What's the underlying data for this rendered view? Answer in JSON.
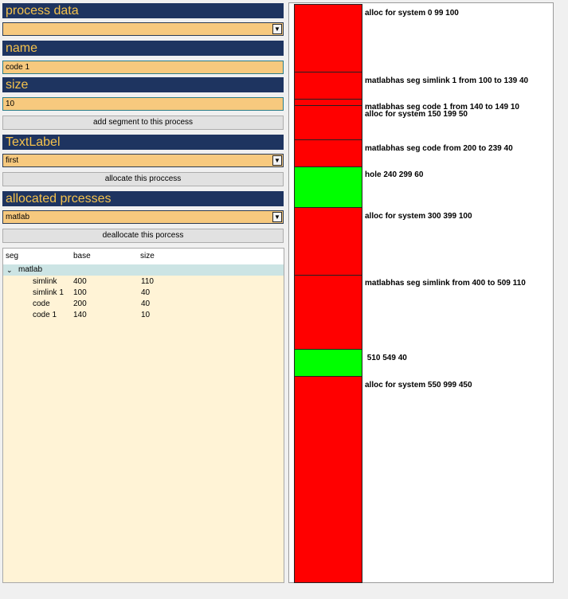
{
  "colors": {
    "alloc": "#ff0000",
    "hole": "#00ff00"
  },
  "process_data": {
    "header": "process data",
    "value": ""
  },
  "name": {
    "header": "name",
    "value": "code 1"
  },
  "size": {
    "header": "size",
    "value": "10"
  },
  "add_segment_label": "add segment to this process",
  "text_label": {
    "header": "TextLabel",
    "value": "first"
  },
  "allocate_label": "allocate this proccess",
  "allocated": {
    "header": "allocated prcesses",
    "value": "matlab"
  },
  "deallocate_label": "deallocate this porcess",
  "tree": {
    "columns": [
      "seg",
      "base",
      "size"
    ],
    "parent": "matlab",
    "rows": [
      {
        "seg": "simlink",
        "base": "400",
        "size": "110"
      },
      {
        "seg": "simlink 1",
        "base": "100",
        "size": "40"
      },
      {
        "seg": "code",
        "base": "200",
        "size": "40"
      },
      {
        "seg": "code 1",
        "base": "140",
        "size": "10"
      }
    ]
  },
  "memory_map": [
    {
      "type": "alloc",
      "label": "alloc for system 0 99 100"
    },
    {
      "type": "alloc",
      "label": "matlabhas seg simlink 1 from 100 to 139 40"
    },
    {
      "type": "alloc",
      "label": "matlabhas seg code 1 from 140 to 149 10"
    },
    {
      "type": "alloc",
      "label": "alloc for system 150 199 50"
    },
    {
      "type": "alloc",
      "label": "matlabhas seg code  from 200 to 239 40"
    },
    {
      "type": "hole",
      "label": "hole 240 299 60"
    },
    {
      "type": "alloc",
      "label": "alloc for system 300 399 100"
    },
    {
      "type": "alloc",
      "label": "matlabhas seg simlink from 400 to 509 110"
    },
    {
      "type": "hole",
      "label": " 510 549 40"
    },
    {
      "type": "alloc",
      "label": "alloc for system 550 999 450"
    }
  ]
}
